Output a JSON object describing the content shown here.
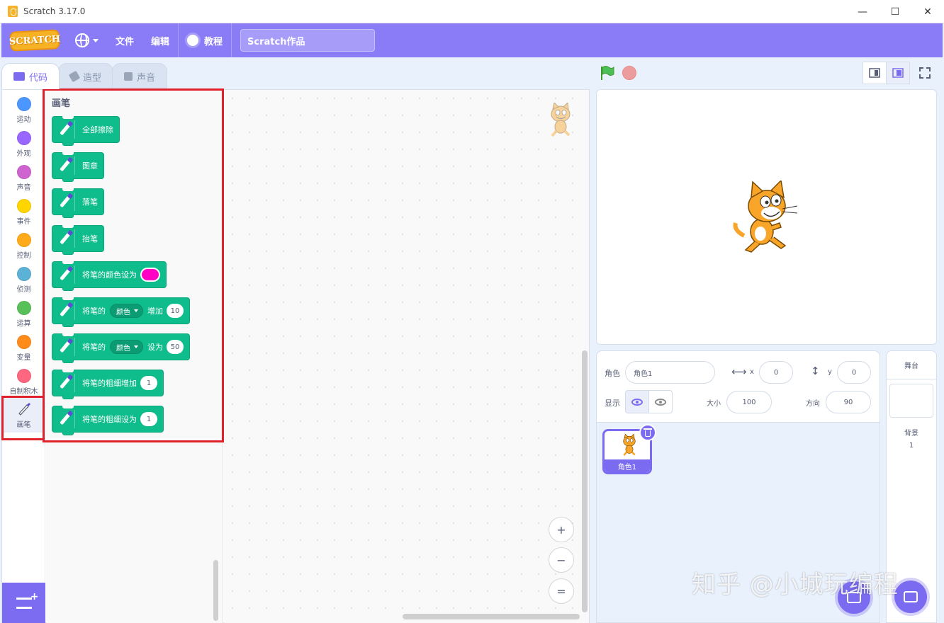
{
  "window": {
    "title": "Scratch 3.17.0",
    "controls": [
      "—",
      "☐",
      "✕"
    ]
  },
  "menubar": {
    "logo": "SCRATCH",
    "file": "文件",
    "edit": "编辑",
    "tutorials": "教程",
    "project_title": "Scratch作品"
  },
  "tabs": [
    {
      "label": "代码",
      "active": true
    },
    {
      "label": "造型",
      "active": false
    },
    {
      "label": "声音",
      "active": false
    }
  ],
  "categories": [
    {
      "label": "运动",
      "color": "#4c97ff"
    },
    {
      "label": "外观",
      "color": "#9966ff"
    },
    {
      "label": "声音",
      "color": "#cf63cf"
    },
    {
      "label": "事件",
      "color": "#ffd500"
    },
    {
      "label": "控制",
      "color": "#ffab19"
    },
    {
      "label": "侦测",
      "color": "#5cb1d6"
    },
    {
      "label": "运算",
      "color": "#59c059"
    },
    {
      "label": "变量",
      "color": "#ff8c1a"
    },
    {
      "label": "自制积木",
      "color": "#ff6680"
    },
    {
      "label": "画笔",
      "color": "#0fbd8c",
      "selected": true
    }
  ],
  "palette": {
    "title": "画笔",
    "blocks": [
      {
        "text": "全部擦除"
      },
      {
        "text": "图章"
      },
      {
        "text": "落笔"
      },
      {
        "text": "抬笔"
      },
      {
        "text": "将笔的颜色设为",
        "swatch": "#ff00c4"
      },
      {
        "pre": "将笔的",
        "dropdown": "颜色",
        "mid": "增加",
        "value": "10"
      },
      {
        "pre": "将笔的",
        "dropdown": "颜色",
        "mid": "设为",
        "value": "50"
      },
      {
        "text": "将笔的粗细增加",
        "value": "1"
      },
      {
        "text": "将笔的粗细设为",
        "value": "1"
      }
    ]
  },
  "zoom": {
    "in": "+",
    "out": "−",
    "reset": "="
  },
  "sprite_info": {
    "sprite_label": "角色",
    "sprite_name": "角色1",
    "x_label": "x",
    "x_value": "0",
    "y_label": "y",
    "y_value": "0",
    "show_label": "显示",
    "size_label": "大小",
    "size_value": "100",
    "direction_label": "方向",
    "direction_value": "90"
  },
  "sprite_list": [
    {
      "name": "角色1"
    }
  ],
  "stage_pane": {
    "title": "舞台",
    "backdrop_label": "背景",
    "backdrop_count": "1"
  },
  "watermark": "知乎 @小城玩编程",
  "colors": {
    "menubar": "#8a7cf6",
    "pen_block": "#0fbd8c",
    "highlight": "#e0202a"
  }
}
